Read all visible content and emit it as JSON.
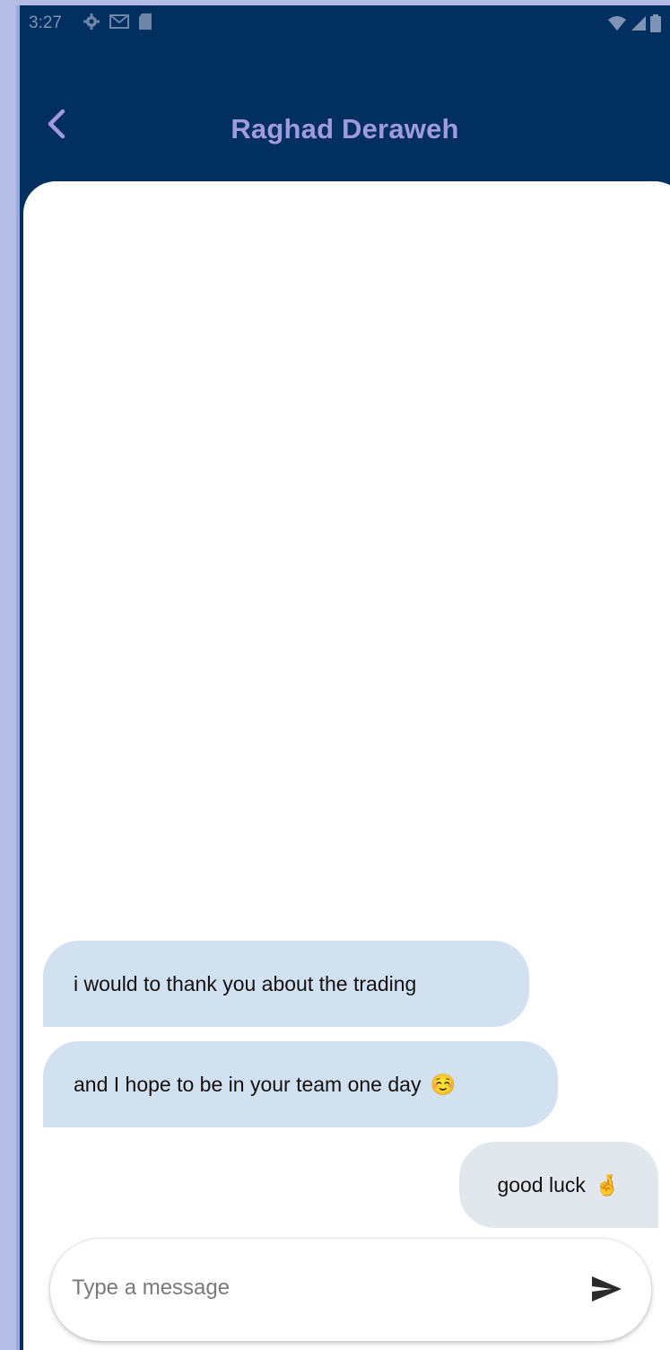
{
  "status_bar": {
    "time": "3:27",
    "left_icons": [
      "gear-icon",
      "gmail-icon",
      "sd-card-icon"
    ],
    "right_icons": [
      "wifi-icon",
      "signal-icon",
      "battery-icon"
    ]
  },
  "header": {
    "title": "Raghad Deraweh",
    "back_icon": "chevron-left-icon"
  },
  "messages": [
    {
      "direction": "incoming",
      "text": "i would to thank you about the trading",
      "emoji": ""
    },
    {
      "direction": "incoming",
      "text": "and I hope to be in your team one day",
      "emoji": "☺️"
    },
    {
      "direction": "outgoing",
      "text": "good luck",
      "emoji": "🤞"
    }
  ],
  "composer": {
    "placeholder": "Type a message",
    "value": "",
    "send_icon": "send-icon"
  },
  "colors": {
    "header_bg": "#002f60",
    "title": "#a29ae0",
    "incoming_bubble": "#d2e1f0",
    "outgoing_bubble": "#e2e7ed",
    "frame": "#b3bde6"
  }
}
